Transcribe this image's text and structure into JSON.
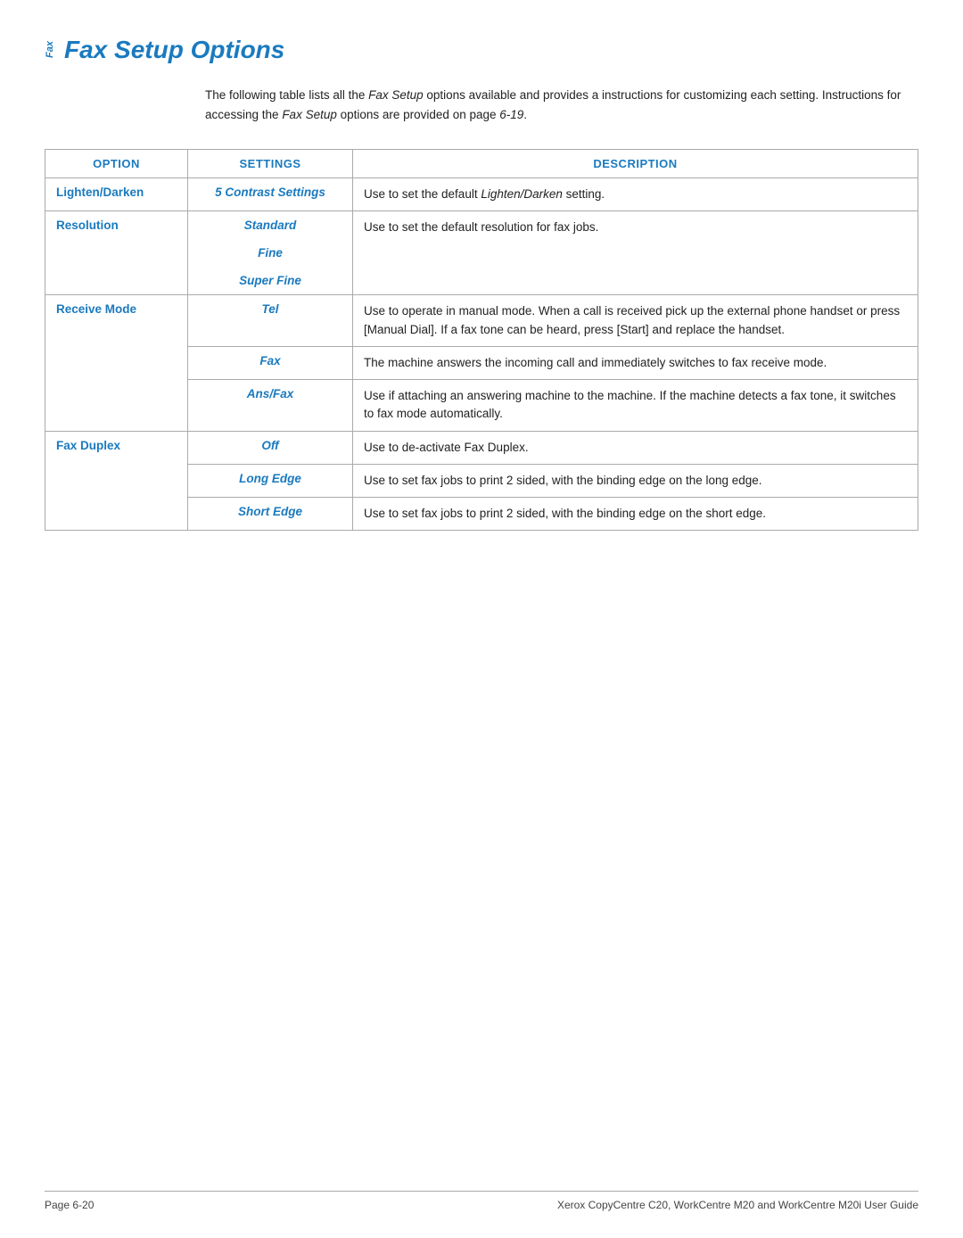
{
  "header": {
    "side_label": "Fax",
    "title": "Fax Setup Options"
  },
  "intro": {
    "text_part1": "The following table lists all the ",
    "italic1": "Fax Setup",
    "text_part2": " options available and provides a instructions for customizing each setting. Instructions for accessing the ",
    "italic2": "Fax Setup",
    "text_part3": " options are provided on page ",
    "italic3": "6-19",
    "text_part4": "."
  },
  "table": {
    "headers": {
      "option": "OPTION",
      "settings": "SETTINGS",
      "description": "DESCRIPTION"
    },
    "rows": [
      {
        "option": "Lighten/Darken",
        "settings": "5 Contrast Settings",
        "description": "Use to set the default Lighten/Darken setting.",
        "desc_italic": "Lighten/Darken"
      },
      {
        "option": "Resolution",
        "settings": [
          "Standard",
          "Fine",
          "Super Fine"
        ],
        "description": "Use to set the default resolution for fax jobs."
      },
      {
        "option": "Receive Mode",
        "settings": [
          {
            "label": "Tel",
            "desc": "Use to operate in manual mode. When a call is received pick up the external phone handset or press [Manual Dial]. If a fax tone can be heard, press [Start] and replace the handset."
          },
          {
            "label": "Fax",
            "desc": "The machine answers the incoming call and immediately switches to fax receive mode."
          },
          {
            "label": "Ans/Fax",
            "desc": "Use if attaching an answering machine to the machine. If the machine detects a fax tone, it switches to fax mode automatically."
          }
        ]
      },
      {
        "option": "Fax Duplex",
        "settings": [
          {
            "label": "Off",
            "desc": "Use to de-activate Fax Duplex."
          },
          {
            "label": "Long Edge",
            "desc": "Use to set fax jobs to print 2 sided, with the binding edge on the long edge."
          },
          {
            "label": "Short Edge",
            "desc": "Use to set fax jobs to print 2 sided, with the binding edge on the short edge."
          }
        ]
      }
    ]
  },
  "footer": {
    "page": "Page 6-20",
    "product": "Xerox CopyCentre C20, WorkCentre M20 and WorkCentre M20i User Guide"
  }
}
